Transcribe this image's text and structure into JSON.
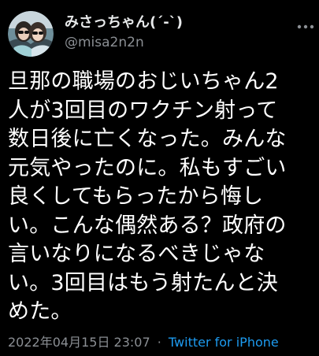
{
  "user": {
    "display_name": "みさっちゃん(´-`)",
    "handle": "@misa2n2n"
  },
  "tweet": {
    "text": "旦那の職場のおじいちゃん2\n人が3回目のワクチン射って\n数日後に亡くなった。みんな\n元気やったのに。私もすごい\n良くしてもらったから悔し\nい。こんな偶然ある？政府の\n言いなりになるべきじゃな\nい。3回目はもう射たんと決\nめた。",
    "timestamp": "2022年04月15日 23:07",
    "separator": "·",
    "source": "Twitter for iPhone"
  },
  "icons": {
    "avatar": "avatar-photo",
    "more": "more-dots-icon"
  },
  "colors": {
    "background": "#000000",
    "text": "#ffffff",
    "secondary": "#8b8f94",
    "link": "#1d9bf0"
  }
}
